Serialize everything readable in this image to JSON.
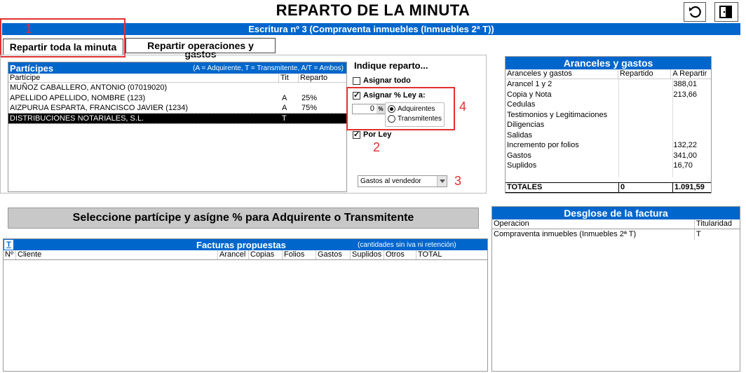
{
  "title": "REPARTO DE LA MINUTA",
  "escritura_bar": "Escritura nº 3 (Compraventa inmuebles (Inmuebles 2ª T))",
  "tabs": {
    "repartir_toda": "Repartir toda la minuta",
    "repartir_ops": "Repartir operaciones y gastos"
  },
  "annotations": [
    "1",
    "2",
    "3",
    "4"
  ],
  "participes": {
    "title": "Partícipes",
    "legend": "(A = Adquirente, T = Transmitente, A/T = Ambos)",
    "columns": [
      "Partícipe",
      "Tit",
      "Reparto"
    ],
    "rows": [
      {
        "name": "MUÑOZ CABALLERO, ANTONIO (07019020)",
        "tit": "",
        "reparto": ""
      },
      {
        "name": "APELLIDO APELLIDO, NOMBRE (123)",
        "tit": "A",
        "reparto": "25%"
      },
      {
        "name": "AIZPURUA ESPARTA, FRANCISCO JAVIER (1234)",
        "tit": "A",
        "reparto": "75%"
      },
      {
        "name": "DISTRIBUCIONES NOTARIALES, S.L.",
        "tit": "T",
        "reparto": ""
      }
    ]
  },
  "reparto": {
    "heading": "Indique reparto...",
    "asignar_todo": "Asignar todo",
    "asignar_ley": "Asignar % Ley a:",
    "pct_value": "0",
    "pct_symbol": "%",
    "adquirentes": "Adquirentes",
    "transmitentes": "Transmitentes",
    "por_ley": "Por Ley",
    "gastos_select": "Gastos al vendedor"
  },
  "aranceles": {
    "title": "Aranceles y gastos",
    "columns": [
      "Aranceles y gastos",
      "Repartido",
      "A Repartir"
    ],
    "rows": [
      {
        "name": "Arancel 1 y 2",
        "repartido": "",
        "a_repartir": "388,01"
      },
      {
        "name": "Copia y Nota",
        "repartido": "",
        "a_repartir": "213,66"
      },
      {
        "name": "Cedulas",
        "repartido": "",
        "a_repartir": ""
      },
      {
        "name": "Testimonios y Legitimaciones",
        "repartido": "",
        "a_repartir": ""
      },
      {
        "name": "Diligencias",
        "repartido": "",
        "a_repartir": ""
      },
      {
        "name": "Salidas",
        "repartido": "",
        "a_repartir": ""
      },
      {
        "name": "Incremento por folios",
        "repartido": "",
        "a_repartir": "132,22"
      },
      {
        "name": "Gastos",
        "repartido": "",
        "a_repartir": "341,00"
      },
      {
        "name": "Suplidos",
        "repartido": "",
        "a_repartir": "16,70"
      }
    ],
    "totals": {
      "label": "TOTALES",
      "repartido": "0",
      "a_repartir": "1.091,59"
    }
  },
  "message_bar": "Seleccione partícipe y asígne % para Adquirente o Transmitente",
  "facturas": {
    "t_button": "T",
    "title": "Facturas propuestas",
    "note": "(cantidades sin iva ni retención)",
    "columns": [
      "Nº",
      "Cliente",
      "Arancel",
      "Copias",
      "Folios",
      "Gastos",
      "Suplidos",
      "Otros",
      "TOTAL"
    ]
  },
  "desglose": {
    "title": "Desglose de la factura",
    "columns": [
      "Operacion",
      "Titularidad"
    ],
    "rows": [
      {
        "operacion": "Compraventa inmuebles (Inmuebles 2ª T)",
        "titularidad": "T"
      }
    ]
  },
  "colors": {
    "blue": "#0066cc",
    "red_annotation": "#e03030",
    "selected_row": "#000000"
  },
  "icons": {
    "undo": "undo-icon",
    "exit": "exit-door-icon"
  }
}
